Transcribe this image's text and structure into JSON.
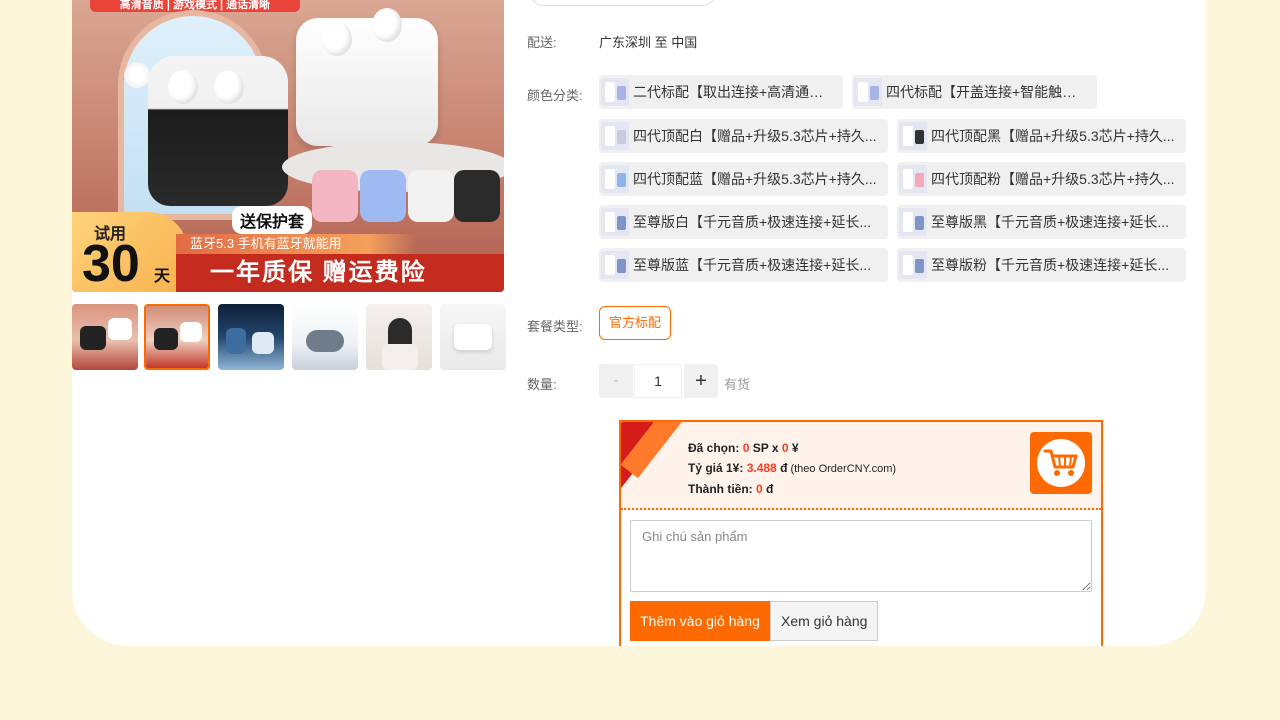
{
  "main_image": {
    "top_banner": "高清音质 | 游戏模式 | 通话清晰",
    "try_label": "试用",
    "try_number": "30",
    "try_unit": "天",
    "case_tag": "送保护套",
    "bluetooth_text": "蓝牙5.3   手机有蓝牙就能用",
    "warranty_text": "一年质保  赠运费险"
  },
  "shipping": {
    "label": "配送:",
    "value": "广东深圳 至 中国"
  },
  "color": {
    "label": "颜色分类:",
    "options": [
      {
        "label": "二代标配【取出连接+高清通话】",
        "tint": "#a7b3e6"
      },
      {
        "label": "四代标配【开盖连接+智能触控】",
        "tint": "#a7b3e6"
      },
      {
        "label": "四代顶配白【赠品+升级5.3芯片+持久...",
        "tint": "#c6cbe0"
      },
      {
        "label": "四代顶配黑【赠品+升级5.3芯片+持久...",
        "tint": "#333333"
      },
      {
        "label": "四代顶配蓝【赠品+升级5.3芯片+持久...",
        "tint": "#8fb4ea"
      },
      {
        "label": "四代顶配粉【赠品+升级5.3芯片+持久...",
        "tint": "#f2a9b9"
      },
      {
        "label": "至尊版白【千元音质+极速连接+延长...",
        "tint": "#7f95c9"
      },
      {
        "label": "至尊版黑【千元音质+极速连接+延长...",
        "tint": "#7f95c9"
      },
      {
        "label": "至尊版蓝【千元音质+极速连接+延长...",
        "tint": "#7f95c9"
      },
      {
        "label": "至尊版粉【千元音质+极速连接+延长...",
        "tint": "#7f95c9"
      }
    ]
  },
  "package": {
    "label": "套餐类型:",
    "selected": "官方标配"
  },
  "quantity": {
    "label": "数量:",
    "minus": "-",
    "value": "1",
    "plus": "+",
    "stock": "有货"
  },
  "order": {
    "selected_label": "Đã chọn:",
    "selected_count": "0",
    "sp_x": " SP x ",
    "selected_price": "0",
    "yen": " ¥",
    "rate_label": "Tỷ giá 1¥:",
    "rate_value": "3.488",
    "rate_unit": " đ",
    "rate_source": " (theo OrderCNY.com)",
    "total_label": "Thành tiền:",
    "total_value": "0",
    "total_unit": " đ",
    "note_placeholder": "Ghi chú sản phẩm",
    "add_to_cart": "Thêm vào giỏ hàng",
    "view_cart": "Xem giỏ hàng"
  },
  "colors": {
    "accent": "#ff6a00",
    "page_bg": "#fdf6db"
  }
}
